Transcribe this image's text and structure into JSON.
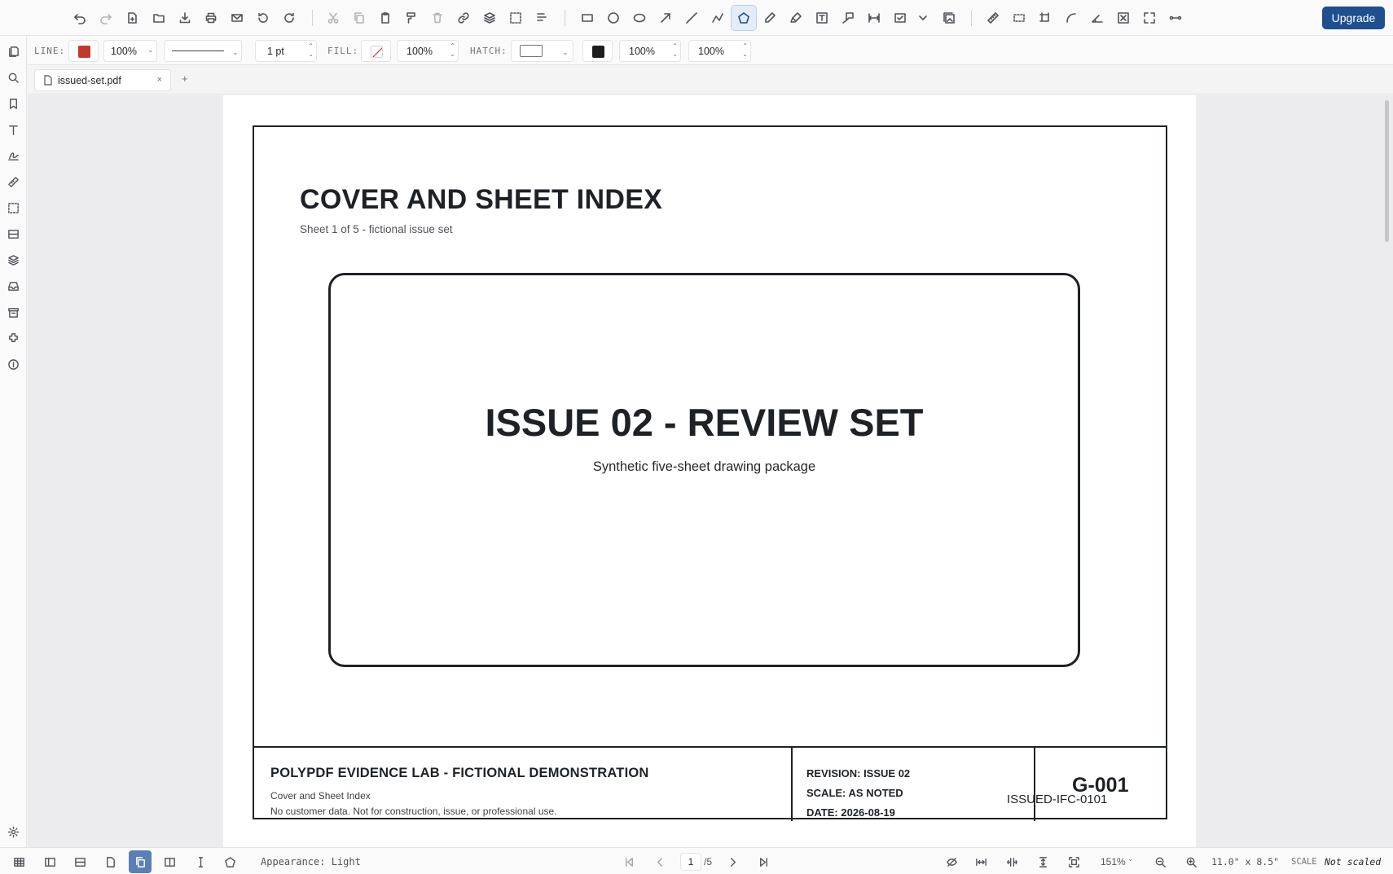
{
  "toolbar": {
    "upgrade_label": "Upgrade"
  },
  "properties": {
    "line_label": "LINE:",
    "line_color": "#c0392b",
    "line_opacity": "100%",
    "line_width": "1 pt",
    "fill_label": "FILL:",
    "fill_opacity": "100%",
    "hatch_label": "HATCH:",
    "hatch_color": "#1e1e1e",
    "hatch_opacity_1": "100%",
    "hatch_opacity_2": "100%"
  },
  "tabs": {
    "file_name": "issued-set.pdf",
    "close_glyph": "×",
    "add_glyph": "+"
  },
  "document": {
    "title": "COVER AND SHEET INDEX",
    "subtitle": "Sheet 1 of 5 - fictional issue set",
    "issue_title": "ISSUE 02 - REVIEW SET",
    "issue_subtitle": "Synthetic five-sheet drawing package",
    "titleblock": {
      "org_name": "POLYPDF EVIDENCE LAB - FICTIONAL DEMONSTRATION",
      "sheet_name": "Cover and Sheet Index",
      "disclaimer": "No customer data. Not for construction, issue, or professional use.",
      "revision": "REVISION: ISSUE 02",
      "scale": "SCALE: AS NOTED",
      "date": "DATE: 2026-08-19",
      "sheet_number": "G-001",
      "doc_code": "ISSUED-IFC-0101"
    }
  },
  "status": {
    "appearance": "Appearance: Light",
    "current_page": "1",
    "total_pages": "/5",
    "zoom": "151%",
    "page_size": "11.0\" x 8.5\"",
    "scale_label": "SCALE",
    "scale_value": "Not scaled"
  },
  "colors": {
    "accent": "#1f4f8f",
    "active_view": "#5a7fb5"
  }
}
